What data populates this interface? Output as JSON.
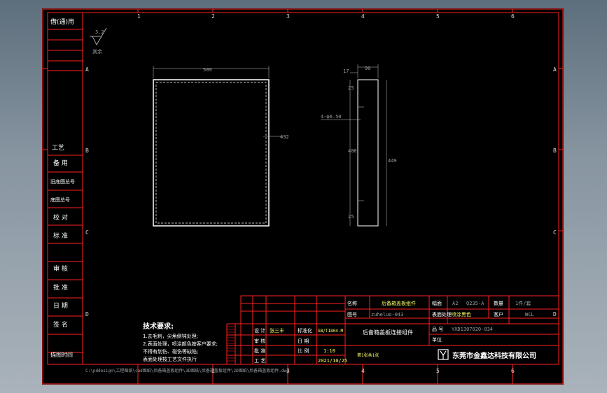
{
  "drawing": {
    "col_labels": [
      "1",
      "2",
      "3",
      "4",
      "5",
      "6"
    ],
    "row_labels": [
      "A",
      "B",
      "C",
      "D"
    ],
    "left_stamp": {
      "top": "借(通)用",
      "middle": "工艺",
      "items": [
        "备 用",
        "旧底图总号",
        "底图总号",
        "校 对",
        "标 准",
        "审 核",
        "批 准",
        "日 期",
        "签 名",
        "描图时间"
      ]
    },
    "dims": {
      "width": "509",
      "height": "432",
      "side_width": "90",
      "side_top": "17",
      "hole_spec": "4-φ6.50",
      "spacing_top": "25",
      "spacing_mid": "400",
      "spacing_bottom": "25",
      "side_height": "449"
    },
    "surface_mark": {
      "value": "3.2",
      "label": "其余"
    },
    "tech_req": {
      "title": "技术要求:",
      "lines": [
        "1.去毛刺，尖角倒钝处理;",
        "2.表面处理，喷涂颜色按客户要求;",
        "不得有划伤、碰伤等缺陷;",
        "表面处理按工艺文件执行"
      ]
    },
    "title_block": {
      "label_designer": "设 计",
      "designer": "张三丰",
      "label_std": "标准化",
      "std": "GB/T1804-M",
      "label_check": "审 核",
      "label_approve": "批 准",
      "label_process": "工 艺",
      "label_date": "日 期",
      "label_scale": "比 例",
      "scale": "1:10",
      "date": "2021/10/25",
      "label_name": "名称",
      "name": "后备箱盖板组件",
      "label_drawno": "图号",
      "drawno": "zuheluo-043",
      "part_desc": "后备箱盖板连接组件",
      "label_sheet": "幅面",
      "sheet": "A2",
      "sheet_count": "第1张共1张",
      "label_material": "材料",
      "material": "Q235-A",
      "label_qty": "数量",
      "qty": "1件/套",
      "label_treatment": "表面处理",
      "treatment": "喷涂黑色",
      "label_customer": "客户",
      "customer": "WCL",
      "label_partno": "品 号",
      "partno": "YXD1307020-034",
      "label_unit": "单位",
      "unit": "件",
      "company": "东莞市金鑫达科技有限公司"
    },
    "file_path": "C:\\pddesign\\工程图纸\\cad图纸\\后备箱盖板组件\\3D图纸\\后备箱盖板组件\\2D图纸\\后备箱盖板组件.dwg",
    "colors": {
      "border": "#ff2020",
      "lines": "#ffffff",
      "dims": "#c8c8c8",
      "bg": "#000000",
      "text_yellow": "#ffff66"
    }
  }
}
